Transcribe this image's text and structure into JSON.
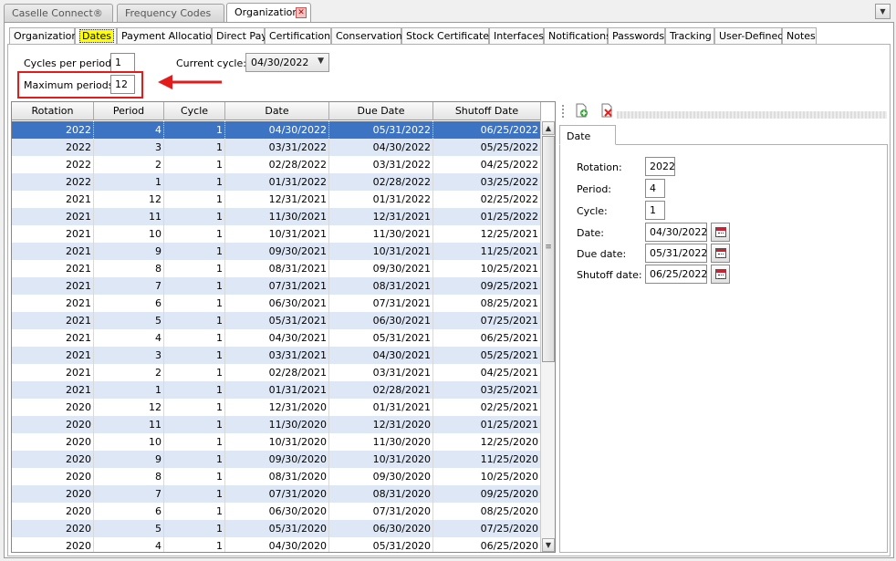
{
  "doc_tabs": [
    {
      "label": "Caselle Connect®"
    },
    {
      "label": "Frequency Codes"
    },
    {
      "label": "Organization"
    }
  ],
  "sub_tabs": [
    {
      "label": "Organization"
    },
    {
      "label": "Dates"
    },
    {
      "label": "Payment Allocation"
    },
    {
      "label": "Direct Pay"
    },
    {
      "label": "Certification"
    },
    {
      "label": "Conservation"
    },
    {
      "label": "Stock Certificates"
    },
    {
      "label": "Interfaces"
    },
    {
      "label": "Notifications"
    },
    {
      "label": "Passwords"
    },
    {
      "label": "Tracking"
    },
    {
      "label": "User-Defined"
    },
    {
      "label": "Notes"
    }
  ],
  "settings": {
    "cycles_per_period_label": "Cycles per period:",
    "cycles_per_period_value": "1",
    "maximum_periods_label": "Maximum periods:",
    "maximum_periods_value": "12",
    "current_cycle_label": "Current cycle:",
    "current_cycle_value": "04/30/2022"
  },
  "grid": {
    "columns": [
      "Rotation",
      "Period",
      "Cycle",
      "Date",
      "Due Date",
      "Shutoff Date"
    ],
    "rows": [
      [
        "2022",
        "4",
        "1",
        "04/30/2022",
        "05/31/2022",
        "06/25/2022"
      ],
      [
        "2022",
        "3",
        "1",
        "03/31/2022",
        "04/30/2022",
        "05/25/2022"
      ],
      [
        "2022",
        "2",
        "1",
        "02/28/2022",
        "03/31/2022",
        "04/25/2022"
      ],
      [
        "2022",
        "1",
        "1",
        "01/31/2022",
        "02/28/2022",
        "03/25/2022"
      ],
      [
        "2021",
        "12",
        "1",
        "12/31/2021",
        "01/31/2022",
        "02/25/2022"
      ],
      [
        "2021",
        "11",
        "1",
        "11/30/2021",
        "12/31/2021",
        "01/25/2022"
      ],
      [
        "2021",
        "10",
        "1",
        "10/31/2021",
        "11/30/2021",
        "12/25/2021"
      ],
      [
        "2021",
        "9",
        "1",
        "09/30/2021",
        "10/31/2021",
        "11/25/2021"
      ],
      [
        "2021",
        "8",
        "1",
        "08/31/2021",
        "09/30/2021",
        "10/25/2021"
      ],
      [
        "2021",
        "7",
        "1",
        "07/31/2021",
        "08/31/2021",
        "09/25/2021"
      ],
      [
        "2021",
        "6",
        "1",
        "06/30/2021",
        "07/31/2021",
        "08/25/2021"
      ],
      [
        "2021",
        "5",
        "1",
        "05/31/2021",
        "06/30/2021",
        "07/25/2021"
      ],
      [
        "2021",
        "4",
        "1",
        "04/30/2021",
        "05/31/2021",
        "06/25/2021"
      ],
      [
        "2021",
        "3",
        "1",
        "03/31/2021",
        "04/30/2021",
        "05/25/2021"
      ],
      [
        "2021",
        "2",
        "1",
        "02/28/2021",
        "03/31/2021",
        "04/25/2021"
      ],
      [
        "2021",
        "1",
        "1",
        "01/31/2021",
        "02/28/2021",
        "03/25/2021"
      ],
      [
        "2020",
        "12",
        "1",
        "12/31/2020",
        "01/31/2021",
        "02/25/2021"
      ],
      [
        "2020",
        "11",
        "1",
        "11/30/2020",
        "12/31/2020",
        "01/25/2021"
      ],
      [
        "2020",
        "10",
        "1",
        "10/31/2020",
        "11/30/2020",
        "12/25/2020"
      ],
      [
        "2020",
        "9",
        "1",
        "09/30/2020",
        "10/31/2020",
        "11/25/2020"
      ],
      [
        "2020",
        "8",
        "1",
        "08/31/2020",
        "09/30/2020",
        "10/25/2020"
      ],
      [
        "2020",
        "7",
        "1",
        "07/31/2020",
        "08/31/2020",
        "09/25/2020"
      ],
      [
        "2020",
        "6",
        "1",
        "06/30/2020",
        "07/31/2020",
        "08/25/2020"
      ],
      [
        "2020",
        "5",
        "1",
        "05/31/2020",
        "06/30/2020",
        "07/25/2020"
      ],
      [
        "2020",
        "4",
        "1",
        "04/30/2020",
        "05/31/2020",
        "06/25/2020"
      ]
    ]
  },
  "detail": {
    "tab_label": "Date",
    "rotation_label": "Rotation:",
    "rotation_value": "2022",
    "period_label": "Period:",
    "period_value": "4",
    "cycle_label": "Cycle:",
    "cycle_value": "1",
    "date_label": "Date:",
    "date_value": "04/30/2022",
    "due_date_label": "Due date:",
    "due_date_value": "05/31/2022",
    "shutoff_date_label": "Shutoff date:",
    "shutoff_date_value": "06/25/2022"
  },
  "icons": {
    "add": "add-row-icon",
    "delete": "delete-row-icon",
    "calendar": "calendar-icon",
    "close": "close-icon",
    "dropdown": "chevron-down-icon"
  },
  "colors": {
    "selected_row": "#3d73c3",
    "alt_row": "#dde7f6",
    "highlight_tab": "#ffff00",
    "annotation_red": "#e31b1b"
  }
}
